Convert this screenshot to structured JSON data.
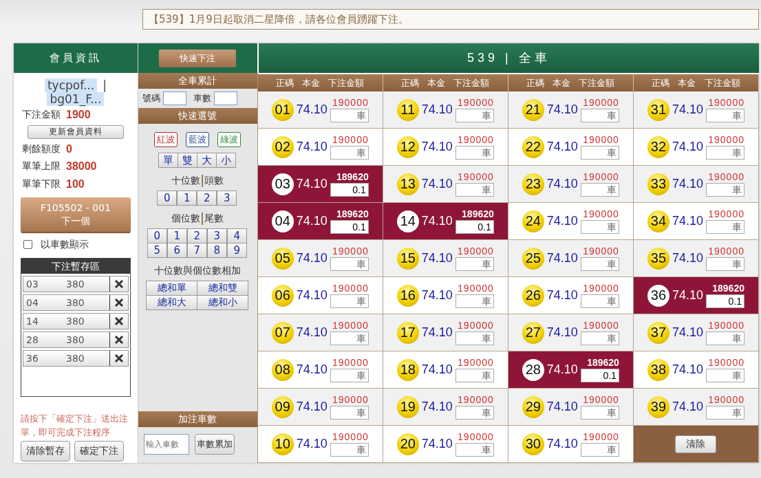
{
  "top": {
    "notice": "【539】1月9日起取消二星降倍，請各位會員踴躍下注。"
  },
  "member": {
    "title": "會員資訊",
    "user": "tycpof...",
    "separator": "|",
    "account": "bg01_F...",
    "bet_amount": {
      "label": "下注金額",
      "value": "1900"
    },
    "refresh_button": "更新會員資料",
    "limits": [
      {
        "label": "剩餘額度",
        "value": "0"
      },
      {
        "label": "單筆上限",
        "value": "38000"
      },
      {
        "label": "單筆下限",
        "value": "100"
      }
    ],
    "next_button": {
      "code": "F105502 - 001",
      "label": "下一個"
    },
    "show_by_count": {
      "label": "以車數顯示",
      "checked": false
    },
    "cart": {
      "title": "下注暫存區",
      "items": [
        {
          "number": "03",
          "amount": "380"
        },
        {
          "number": "04",
          "amount": "380"
        },
        {
          "number": "14",
          "amount": "380"
        },
        {
          "number": "28",
          "amount": "380"
        },
        {
          "number": "36",
          "amount": "380"
        }
      ]
    },
    "note": "請按下「確定下注」送出注單，即可完成下注程序",
    "buttons": [
      "清除暫存",
      "確定下注"
    ]
  },
  "quick": {
    "fast_bet_button": "快速下注",
    "total_title": "全車累計",
    "number_label": "號碼",
    "count_label": "車數",
    "quick_title": "快速選號",
    "waves": [
      {
        "label": "紅波",
        "color": "#b03030"
      },
      {
        "label": "藍波",
        "color": "#2c4f8c"
      },
      {
        "label": "綠波",
        "color": "#2f8a3a"
      }
    ],
    "parity": [
      "單",
      "雙",
      "大",
      "小"
    ],
    "tens_title": [
      "十位數",
      "頭數"
    ],
    "tens": [
      "0",
      "1",
      "2",
      "3"
    ],
    "units_title": [
      "個位數",
      "尾數"
    ],
    "units": [
      "0",
      "1",
      "2",
      "3",
      "4",
      "5",
      "6",
      "7",
      "8",
      "9"
    ],
    "sum_title": "十位數與個位數相加",
    "sums": [
      "總和單",
      "總和雙",
      "總和大",
      "總和小"
    ],
    "add_title": "加注車數",
    "add_placeholder": "輸入車數",
    "add_button": "車數累加"
  },
  "board": {
    "title": "539 | 全車",
    "columns": [
      "正碼 本金 下注金額",
      "正碼 本金 下注金額",
      "正碼 本金 下注金額",
      "正碼 本金 下注金額"
    ],
    "rows": [
      [
        {
          "kind": "number",
          "number": "01",
          "odds": "74.10",
          "limit": "190000",
          "selected": false,
          "placeholder": "車"
        },
        {
          "kind": "number",
          "number": "11",
          "odds": "74.10",
          "limit": "190000",
          "selected": false,
          "placeholder": "車"
        },
        {
          "kind": "number",
          "number": "21",
          "odds": "74.10",
          "limit": "190000",
          "selected": false,
          "placeholder": "車"
        },
        {
          "kind": "number",
          "number": "31",
          "odds": "74.10",
          "limit": "190000",
          "selected": false,
          "placeholder": "車"
        }
      ],
      [
        {
          "kind": "number",
          "number": "02",
          "odds": "74.10",
          "limit": "190000",
          "selected": false,
          "placeholder": "車"
        },
        {
          "kind": "number",
          "number": "12",
          "odds": "74.10",
          "limit": "190000",
          "selected": false,
          "placeholder": "車"
        },
        {
          "kind": "number",
          "number": "22",
          "odds": "74.10",
          "limit": "190000",
          "selected": false,
          "placeholder": "車"
        },
        {
          "kind": "number",
          "number": "32",
          "odds": "74.10",
          "limit": "190000",
          "selected": false,
          "placeholder": "車"
        }
      ],
      [
        {
          "kind": "number",
          "number": "03",
          "odds": "74.10",
          "limit": "189620",
          "selected": true,
          "value": "0.1"
        },
        {
          "kind": "number",
          "number": "13",
          "odds": "74.10",
          "limit": "190000",
          "selected": false,
          "placeholder": "車"
        },
        {
          "kind": "number",
          "number": "23",
          "odds": "74.10",
          "limit": "190000",
          "selected": false,
          "placeholder": "車"
        },
        {
          "kind": "number",
          "number": "33",
          "odds": "74.10",
          "limit": "190000",
          "selected": false,
          "placeholder": "車"
        }
      ],
      [
        {
          "kind": "number",
          "number": "04",
          "odds": "74.10",
          "limit": "189620",
          "selected": true,
          "value": "0.1"
        },
        {
          "kind": "number",
          "number": "14",
          "odds": "74.10",
          "limit": "189620",
          "selected": true,
          "value": "0.1"
        },
        {
          "kind": "number",
          "number": "24",
          "odds": "74.10",
          "limit": "190000",
          "selected": false,
          "placeholder": "車"
        },
        {
          "kind": "number",
          "number": "34",
          "odds": "74.10",
          "limit": "190000",
          "selected": false,
          "placeholder": "車"
        }
      ],
      [
        {
          "kind": "number",
          "number": "05",
          "odds": "74.10",
          "limit": "190000",
          "selected": false,
          "placeholder": "車"
        },
        {
          "kind": "number",
          "number": "15",
          "odds": "74.10",
          "limit": "190000",
          "selected": false,
          "placeholder": "車"
        },
        {
          "kind": "number",
          "number": "25",
          "odds": "74.10",
          "limit": "190000",
          "selected": false,
          "placeholder": "車"
        },
        {
          "kind": "number",
          "number": "35",
          "odds": "74.10",
          "limit": "190000",
          "selected": false,
          "placeholder": "車"
        }
      ],
      [
        {
          "kind": "number",
          "number": "06",
          "odds": "74.10",
          "limit": "190000",
          "selected": false,
          "placeholder": "車"
        },
        {
          "kind": "number",
          "number": "16",
          "odds": "74.10",
          "limit": "190000",
          "selected": false,
          "placeholder": "車"
        },
        {
          "kind": "number",
          "number": "26",
          "odds": "74.10",
          "limit": "190000",
          "selected": false,
          "placeholder": "車"
        },
        {
          "kind": "number",
          "number": "36",
          "odds": "74.10",
          "limit": "189620",
          "selected": true,
          "value": "0.1"
        }
      ],
      [
        {
          "kind": "number",
          "number": "07",
          "odds": "74.10",
          "limit": "190000",
          "selected": false,
          "placeholder": "車"
        },
        {
          "kind": "number",
          "number": "17",
          "odds": "74.10",
          "limit": "190000",
          "selected": false,
          "placeholder": "車"
        },
        {
          "kind": "number",
          "number": "27",
          "odds": "74.10",
          "limit": "190000",
          "selected": false,
          "placeholder": "車"
        },
        {
          "kind": "number",
          "number": "37",
          "odds": "74.10",
          "limit": "190000",
          "selected": false,
          "placeholder": "車"
        }
      ],
      [
        {
          "kind": "number",
          "number": "08",
          "odds": "74.10",
          "limit": "190000",
          "selected": false,
          "placeholder": "車"
        },
        {
          "kind": "number",
          "number": "18",
          "odds": "74.10",
          "limit": "190000",
          "selected": false,
          "placeholder": "車"
        },
        {
          "kind": "number",
          "number": "28",
          "odds": "74.10",
          "limit": "189620",
          "selected": true,
          "value": "0.1"
        },
        {
          "kind": "number",
          "number": "38",
          "odds": "74.10",
          "limit": "190000",
          "selected": false,
          "placeholder": "車"
        }
      ],
      [
        {
          "kind": "number",
          "number": "09",
          "odds": "74.10",
          "limit": "190000",
          "selected": false,
          "placeholder": "車"
        },
        {
          "kind": "number",
          "number": "19",
          "odds": "74.10",
          "limit": "190000",
          "selected": false,
          "placeholder": "車"
        },
        {
          "kind": "number",
          "number": "29",
          "odds": "74.10",
          "limit": "190000",
          "selected": false,
          "placeholder": "車"
        },
        {
          "kind": "number",
          "number": "39",
          "odds": "74.10",
          "limit": "190000",
          "selected": false,
          "placeholder": "車"
        }
      ],
      [
        {
          "kind": "number",
          "number": "10",
          "odds": "74.10",
          "limit": "190000",
          "selected": false,
          "placeholder": "車"
        },
        {
          "kind": "number",
          "number": "20",
          "odds": "74.10",
          "limit": "190000",
          "selected": false,
          "placeholder": "車"
        },
        {
          "kind": "number",
          "number": "30",
          "odds": "74.10",
          "limit": "190000",
          "selected": false,
          "placeholder": "車"
        },
        {
          "kind": "actions",
          "buttons": [
            "清除"
          ]
        }
      ]
    ]
  }
}
